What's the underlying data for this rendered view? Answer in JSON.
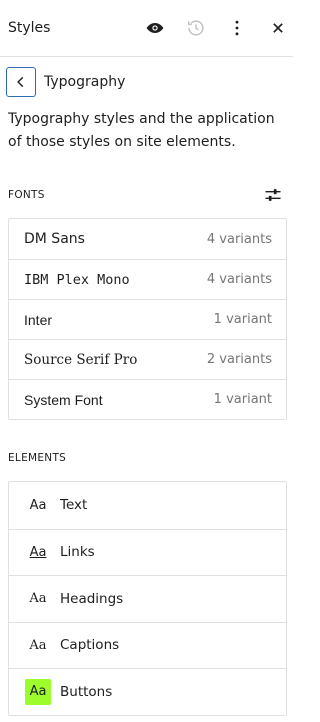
{
  "header": {
    "title": "Styles",
    "icons": [
      "eye-icon",
      "history-icon",
      "more-vertical-icon",
      "close-icon"
    ]
  },
  "nav": {
    "back_icon": "chevron-left-icon",
    "title": "Typography"
  },
  "description": "Typography styles and the application of those styles on site elements.",
  "fonts": {
    "label": "FONTS",
    "settings_icon": "sliders-icon",
    "items": [
      {
        "name": "DM Sans",
        "variants": "4 variants"
      },
      {
        "name": "IBM Plex Mono",
        "variants": "4 variants"
      },
      {
        "name": "Inter",
        "variants": "1 variant"
      },
      {
        "name": "Source Serif Pro",
        "variants": "2 variants"
      },
      {
        "name": "System Font",
        "variants": "1 variant"
      }
    ]
  },
  "elements": {
    "label": "ELEMENTS",
    "items": [
      {
        "preview": "Aa",
        "label": "Text"
      },
      {
        "preview": "Aa",
        "label": "Links"
      },
      {
        "preview": "Aa",
        "label": "Headings"
      },
      {
        "preview": "Aa",
        "label": "Captions"
      },
      {
        "preview": "Aa",
        "label": "Buttons"
      }
    ]
  },
  "colors": {
    "accent_border": "#2a6db5",
    "button_preview_bg": "#9dfc2c",
    "muted_text": "#757575",
    "divider": "#e0e0e0"
  }
}
